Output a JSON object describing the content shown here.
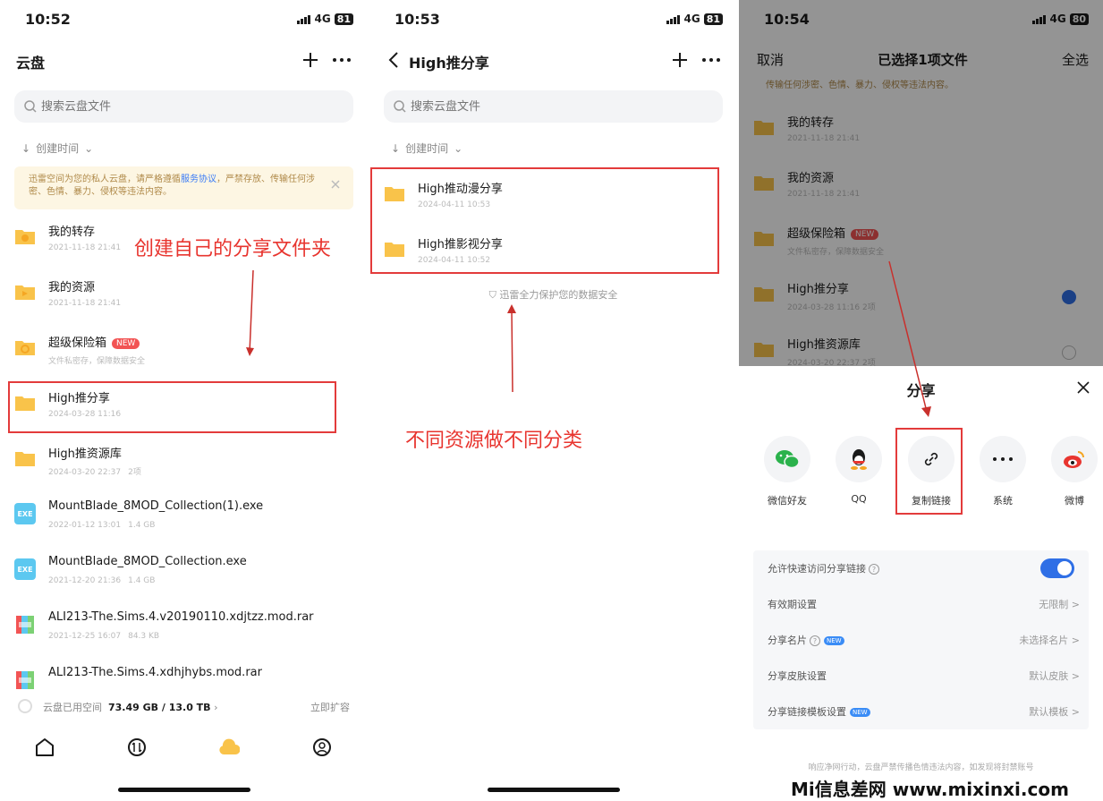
{
  "panel1": {
    "time": "10:52",
    "network": "4G",
    "battery": "81",
    "title": "云盘",
    "search_placeholder": "搜索云盘文件",
    "sort_label": "创建时间",
    "notice_pre": "迅雷空间为您的私人云盘，请严格遵循",
    "notice_link": "服务协议",
    "notice_post": "，严禁存放、传输任何涉密、色情、暴力、侵权等违法内容。",
    "files": [
      {
        "name": "我的转存",
        "date": "2021-11-18 21:41",
        "extra": ""
      },
      {
        "name": "我的资源",
        "date": "2021-11-18 21:41",
        "extra": ""
      },
      {
        "name": "超级保险箱",
        "date": "文件私密存，保障数据安全",
        "extra": ""
      },
      {
        "name": "High推分享",
        "date": "2024-03-28 11:16",
        "extra": ""
      },
      {
        "name": "High推资源库",
        "date": "2024-03-20 22:37",
        "extra": "2项"
      },
      {
        "name": "MountBlade_8MOD_Collection(1).exe",
        "date": "2022-01-12 13:01",
        "extra": "1.4 GB"
      },
      {
        "name": "MountBlade_8MOD_Collection.exe",
        "date": "2021-12-20 21:36",
        "extra": "1.4 GB"
      },
      {
        "name": "ALI213-The.Sims.4.v20190110.xdjtzz.mod.rar",
        "date": "2021-12-25 16:07",
        "extra": "84.3 KB"
      },
      {
        "name": "ALI213-The.Sims.4.xdhjhybs.mod.rar",
        "date": "",
        "extra": ""
      }
    ],
    "new_badge": "NEW",
    "exe_label": "EXE",
    "storage_label": "云盘已用空间",
    "storage_value": "73.49 GB / 13.0 TB",
    "storage_action": "立即扩容",
    "annotation": "创建自己的分享文件夹"
  },
  "panel2": {
    "time": "10:53",
    "network": "4G",
    "battery": "81",
    "title": "High推分享",
    "search_placeholder": "搜索云盘文件",
    "sort_label": "创建时间",
    "files": [
      {
        "name": "High推动漫分享",
        "date": "2024-04-11 10:53"
      },
      {
        "name": "High推影视分享",
        "date": "2024-04-11 10:52"
      }
    ],
    "secure_text": "迅雷全力保护您的数据安全",
    "annotation": "不同资源做不同分类"
  },
  "panel3": {
    "time": "10:54",
    "network": "4G",
    "battery": "80",
    "cancel": "取消",
    "selected": "已选择1项文件",
    "select_all": "全选",
    "notice_partial": "传输任何涉密、色情、暴力、侵权等违法内容。",
    "files": [
      {
        "name": "我的转存",
        "date": "2021-11-18 21:41"
      },
      {
        "name": "我的资源",
        "date": "2021-11-18 21:41"
      },
      {
        "name": "超级保险箱",
        "date": "文件私密存，保障数据安全"
      },
      {
        "name": "High推分享",
        "date": "2024-03-28 11:16  2项"
      },
      {
        "name": "High推资源库",
        "date": "2024-03-20 22:37  2项"
      }
    ],
    "share_title": "分享",
    "share_options": [
      "微信好友",
      "QQ",
      "复制链接",
      "系统",
      "微博"
    ],
    "settings": [
      {
        "label": "允许快速访问分享链接",
        "value": ""
      },
      {
        "label": "有效期设置",
        "value": "无限制 >"
      },
      {
        "label": "分享名片",
        "value": "未选择名片 >"
      },
      {
        "label": "分享皮肤设置",
        "value": "默认皮肤 >"
      },
      {
        "label": "分享链接模板设置",
        "value": "默认模板 >"
      }
    ],
    "new_tag": "NEW",
    "footnote": "响应净网行动，云盘严禁传播色情违法内容，如发现将封禁账号"
  },
  "watermark": "Mi信息差网 www.mixinxi.com",
  "colors": {
    "accent": "#2f6fe6",
    "annotation": "#e8352f",
    "folder": "#f9c34a"
  }
}
